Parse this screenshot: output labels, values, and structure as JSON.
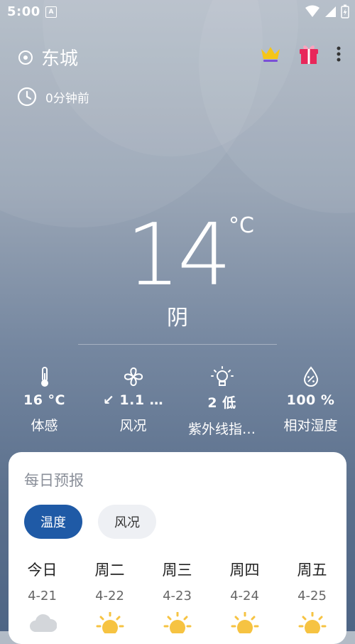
{
  "status_bar": {
    "time": "5:00",
    "notification_letter": "A"
  },
  "header": {
    "location": "东城",
    "updated": "0分钟前"
  },
  "current": {
    "temperature": "14",
    "unit": "°C",
    "condition": "阴"
  },
  "metrics": [
    {
      "icon": "thermometer-icon",
      "value": "16 °C",
      "label": "体感"
    },
    {
      "icon": "fan-icon",
      "value": "↙ 1.1 …",
      "label": "风况"
    },
    {
      "icon": "bulb-icon",
      "value": "2 低",
      "label": "紫外线指…"
    },
    {
      "icon": "humidity-icon",
      "value": "100 %",
      "label": "相对湿度"
    }
  ],
  "forecast": {
    "title": "每日预报",
    "tabs": [
      {
        "label": "温度",
        "active": true
      },
      {
        "label": "风况",
        "active": false
      }
    ],
    "days": [
      {
        "name": "今日",
        "date": "4-21",
        "icon": "cloud-icon"
      },
      {
        "name": "周二",
        "date": "4-22",
        "icon": "sun-icon"
      },
      {
        "name": "周三",
        "date": "4-23",
        "icon": "sun-icon"
      },
      {
        "name": "周四",
        "date": "4-24",
        "icon": "sun-icon"
      },
      {
        "name": "周五",
        "date": "4-25",
        "icon": "sun-icon"
      }
    ]
  },
  "colors": {
    "accent": "#1f5aa6",
    "crown": "#f5c518",
    "gift": "#e8275a"
  }
}
